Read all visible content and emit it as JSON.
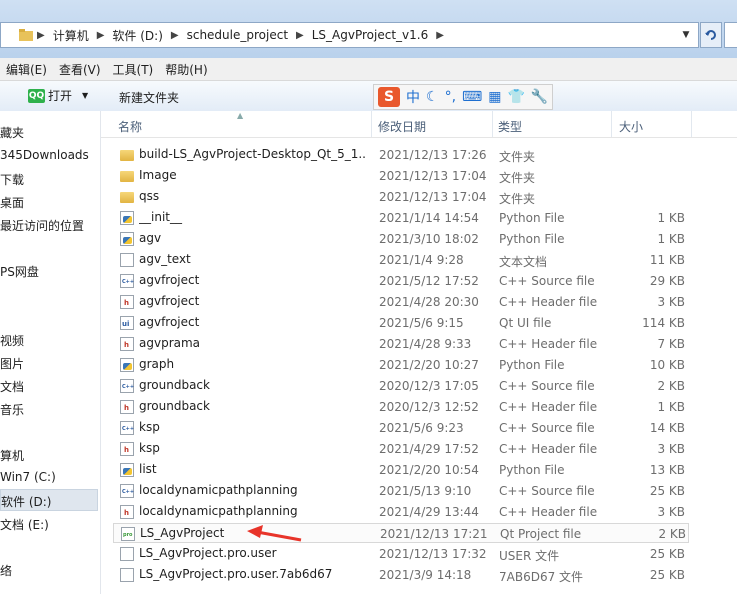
{
  "address": {
    "crumbs": [
      "计算机",
      "软件 (D:)",
      "schedule_project",
      "LS_AgvProject_v1.6"
    ]
  },
  "menu": [
    "编辑(E)",
    "查看(V)",
    "工具(T)",
    "帮助(H)"
  ],
  "toolbar": {
    "open_badge": "QQ",
    "open_label": "打开",
    "new_folder_label": "新建文件夹"
  },
  "ime": {
    "logo": "S",
    "mode": "中"
  },
  "nav": [
    {
      "label": "藏夹"
    },
    {
      "label": "345Downloads"
    },
    {
      "label": "下载"
    },
    {
      "label": "桌面"
    },
    {
      "label": "最近访问的位置"
    },
    {
      "label": "PS网盘"
    },
    {
      "label": "视频"
    },
    {
      "label": "图片"
    },
    {
      "label": "文档"
    },
    {
      "label": "音乐"
    },
    {
      "label": "算机"
    },
    {
      "label": "Win7 (C:)"
    },
    {
      "label": "软件 (D:)"
    },
    {
      "label": "文档 (E:)"
    },
    {
      "label": "络"
    }
  ],
  "columns": {
    "name": "名称",
    "date": "修改日期",
    "type": "类型",
    "size": "大小"
  },
  "files": [
    {
      "name": "build-LS_AgvProject-Desktop_Qt_5_1...",
      "date": "2021/12/13 17:26",
      "type": "文件夹",
      "size": "",
      "icon": "folder"
    },
    {
      "name": "Image",
      "date": "2021/12/13 17:04",
      "type": "文件夹",
      "size": "",
      "icon": "folder"
    },
    {
      "name": "qss",
      "date": "2021/12/13 17:04",
      "type": "文件夹",
      "size": "",
      "icon": "folder"
    },
    {
      "name": "__init__",
      "date": "2021/1/14 14:54",
      "type": "Python File",
      "size": "1 KB",
      "icon": "python"
    },
    {
      "name": "agv",
      "date": "2021/3/10 18:02",
      "type": "Python File",
      "size": "1 KB",
      "icon": "python"
    },
    {
      "name": "agv_text",
      "date": "2021/1/4 9:28",
      "type": "文本文档",
      "size": "11 KB",
      "icon": "text"
    },
    {
      "name": "agvfroject",
      "date": "2021/5/12 17:52",
      "type": "C++ Source file",
      "size": "29 KB",
      "icon": "cpp"
    },
    {
      "name": "agvfroject",
      "date": "2021/4/28 20:30",
      "type": "C++ Header file",
      "size": "3 KB",
      "icon": "header"
    },
    {
      "name": "agvfroject",
      "date": "2021/5/6 9:15",
      "type": "Qt UI file",
      "size": "114 KB",
      "icon": "ui"
    },
    {
      "name": "agvprama",
      "date": "2021/4/28 9:33",
      "type": "C++ Header file",
      "size": "7 KB",
      "icon": "header"
    },
    {
      "name": "graph",
      "date": "2021/2/20 10:27",
      "type": "Python File",
      "size": "10 KB",
      "icon": "python"
    },
    {
      "name": "groundback",
      "date": "2020/12/3 17:05",
      "type": "C++ Source file",
      "size": "2 KB",
      "icon": "cpp"
    },
    {
      "name": "groundback",
      "date": "2020/12/3 12:52",
      "type": "C++ Header file",
      "size": "1 KB",
      "icon": "header"
    },
    {
      "name": "ksp",
      "date": "2021/5/6 9:23",
      "type": "C++ Source file",
      "size": "14 KB",
      "icon": "cpp"
    },
    {
      "name": "ksp",
      "date": "2021/4/29 17:52",
      "type": "C++ Header file",
      "size": "3 KB",
      "icon": "header"
    },
    {
      "name": "list",
      "date": "2021/2/20 10:54",
      "type": "Python File",
      "size": "13 KB",
      "icon": "python"
    },
    {
      "name": "localdynamicpathplanning",
      "date": "2021/5/13 9:10",
      "type": "C++ Source file",
      "size": "25 KB",
      "icon": "cpp"
    },
    {
      "name": "localdynamicpathplanning",
      "date": "2021/4/29 13:44",
      "type": "C++ Header file",
      "size": "3 KB",
      "icon": "header"
    },
    {
      "name": "LS_AgvProject",
      "date": "2021/12/13 17:21",
      "type": "Qt Project file",
      "size": "2 KB",
      "icon": "pro"
    },
    {
      "name": "LS_AgvProject.pro.user",
      "date": "2021/12/13 17:32",
      "type": "USER 文件",
      "size": "25 KB",
      "icon": "text"
    },
    {
      "name": "LS_AgvProject.pro.user.7ab6d67",
      "date": "2021/3/9 14:18",
      "type": "7AB6D67 文件",
      "size": "25 KB",
      "icon": "text"
    }
  ]
}
